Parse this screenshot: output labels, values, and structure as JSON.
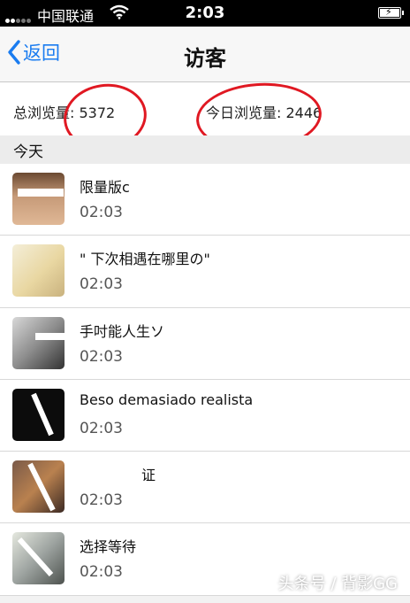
{
  "status_bar": {
    "carrier": "中国联通",
    "time": "2:03"
  },
  "nav": {
    "back_label": "返回",
    "title": "访客"
  },
  "stats": {
    "total_label": "总浏览量: 5372",
    "today_label": "今日浏览量: 2446"
  },
  "section_title": "今天",
  "visitors": [
    {
      "name": "限量版c",
      "time": "02:03"
    },
    {
      "name": "\" 下次相遇在哪里の\"",
      "time": "02:03"
    },
    {
      "name": "手吋能人生ソ",
      "time": "02:03"
    },
    {
      "name": "Beso demasiado realista",
      "time": "02:03"
    },
    {
      "name": "证",
      "time": "02:03"
    },
    {
      "name": "选择等待",
      "time": "02:03"
    }
  ],
  "watermark": "头条号 / 背影GG",
  "colors": {
    "accent": "#1a7cf0",
    "annotation_red": "#e01822"
  }
}
